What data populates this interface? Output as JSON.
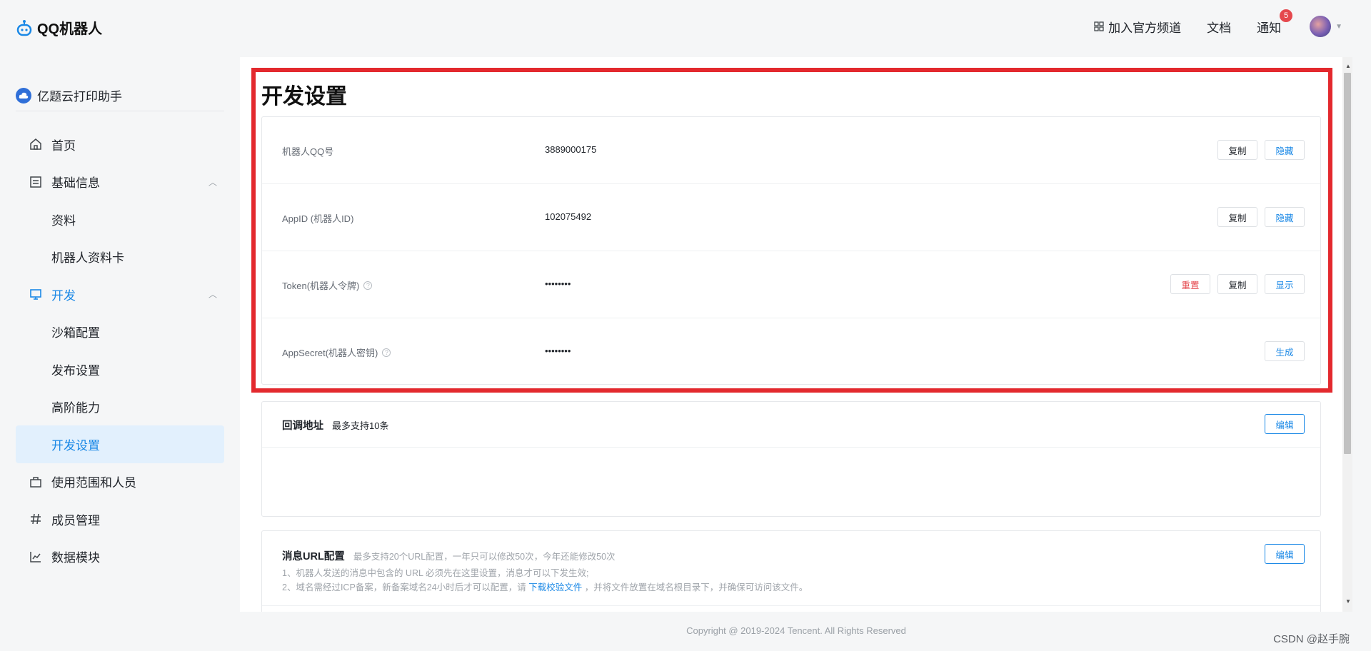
{
  "header": {
    "logo_text": "QQ机器人",
    "join_channel": "加入官方频道",
    "docs": "文档",
    "notify": "通知",
    "notify_count": "5"
  },
  "sidebar": {
    "app_name": "亿题云打印助手",
    "items": [
      {
        "label": "首页",
        "icon": "home-icon"
      },
      {
        "label": "基础信息",
        "icon": "document-icon"
      },
      {
        "label": "资料"
      },
      {
        "label": "机器人资料卡"
      },
      {
        "label": "开发",
        "icon": "monitor-icon"
      },
      {
        "label": "沙箱配置"
      },
      {
        "label": "发布设置"
      },
      {
        "label": "高阶能力"
      },
      {
        "label": "开发设置"
      },
      {
        "label": "使用范围和人员",
        "icon": "bag-icon"
      },
      {
        "label": "成员管理",
        "icon": "hash-icon"
      },
      {
        "label": "数据模块",
        "icon": "chart-icon"
      }
    ]
  },
  "main": {
    "title": "开发设置",
    "keys": [
      {
        "label": "机器人QQ号",
        "value": "3889000175",
        "buttons": [
          "复制",
          "隐藏"
        ]
      },
      {
        "label": "AppID (机器人ID)",
        "value": "102075492",
        "buttons": [
          "复制",
          "隐藏"
        ]
      },
      {
        "label": "Token(机器人令牌)",
        "value": "••••••••",
        "buttons": [
          "重置",
          "复制",
          "显示"
        ]
      },
      {
        "label": "AppSecret(机器人密钥)",
        "value": "••••••••",
        "buttons": [
          "生成"
        ]
      }
    ],
    "callback": {
      "title": "回调地址",
      "subtitle": "最多支持10条",
      "edit": "编辑"
    },
    "message_url": {
      "title": "消息URL配置",
      "subtitle": "最多支持20个URL配置，一年只可以修改50次，今年还能修改50次",
      "note1": "1、机器人发送的消息中包含的 URL 必须先在这里设置，消息才可以下发生效;",
      "note2_prefix": "2、域名需经过ICP备案，新备案域名24小时后才可以配置，请",
      "note2_link": "下载校验文件",
      "note2_suffix": "，并将文件放置在域名根目录下，并确保可访问该文件。",
      "edit": "编辑"
    }
  },
  "footer": {
    "copyright": "Copyright @ 2019-2024 Tencent. All Rights Reserved",
    "watermark": "CSDN @赵手腕"
  },
  "colors": {
    "accent": "#1a88e6",
    "danger": "#e5484d",
    "highlight": "#e3292e",
    "active_bg": "#e2f0fd"
  }
}
